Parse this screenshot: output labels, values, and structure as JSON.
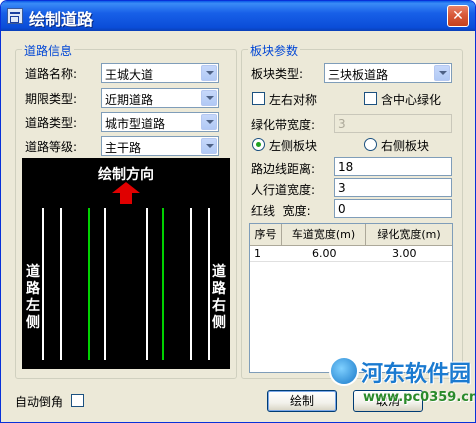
{
  "window": {
    "title": "绘制道路"
  },
  "road_info": {
    "legend": "道路信息",
    "road_name_label": "道路名称:",
    "road_name_value": "王城大道",
    "period_label": "期限类型:",
    "period_value": "近期道路",
    "road_type_label": "道路类型:",
    "road_type_value": "城市型道路",
    "road_grade_label": "道路等级:",
    "road_grade_value": "主干路"
  },
  "preview": {
    "direction_label": "绘制方向",
    "left_side_label": "道路左侧",
    "right_side_label": "道路右侧",
    "line_color_white": "#ffffff",
    "line_color_green": "#00d000",
    "arrow_color": "#e00000"
  },
  "block_params": {
    "legend": "板块参数",
    "block_type_label": "板块类型:",
    "block_type_value": "三块板道路",
    "symmetric_label": "左右对称",
    "center_green_label": "含中心绿化",
    "green_width_label": "绿化带宽度:",
    "green_width_value": "3",
    "left_block_label": "左侧板块",
    "right_block_label": "右侧板块",
    "edge_distance_label": "路边线距离:",
    "edge_distance_value": "18",
    "sidewalk_width_label": "人行道宽度:",
    "sidewalk_width_value": "3",
    "redline_width_label": "红线  宽度:",
    "redline_width_value": "0"
  },
  "grid": {
    "columns": [
      "序号",
      "车道宽度(m)",
      "绿化宽度(m)"
    ],
    "rows": [
      {
        "index": "1",
        "lane_width": "6.00",
        "green_width": "3.00"
      }
    ]
  },
  "footer": {
    "auto_chamfer_label": "自动倒角",
    "draw_button": "绘制",
    "cancel_button": "取消"
  },
  "watermark": {
    "brand": "河东软件园",
    "url": "www.pc0359.cn"
  }
}
